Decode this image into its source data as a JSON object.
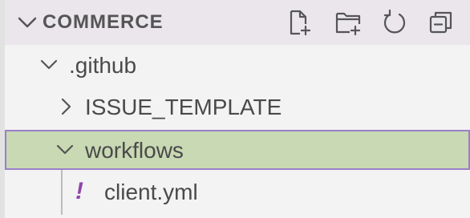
{
  "section": {
    "title": "COMMERCE",
    "actions": [
      {
        "name": "new-file-icon"
      },
      {
        "name": "new-folder-icon"
      },
      {
        "name": "refresh-icon"
      },
      {
        "name": "collapse-all-icon"
      }
    ]
  },
  "tree": [
    {
      "label": ".github",
      "type": "folder",
      "expanded": true
    },
    {
      "label": "ISSUE_TEMPLATE",
      "type": "folder",
      "expanded": false
    },
    {
      "label": "workflows",
      "type": "folder",
      "expanded": true,
      "selected": true
    },
    {
      "label": "client.yml",
      "type": "file",
      "icon": "!"
    }
  ],
  "colors": {
    "selection_bg": "#c8d9b3",
    "selection_border": "#9b7fc9",
    "yml_icon": "#8e44ad"
  }
}
